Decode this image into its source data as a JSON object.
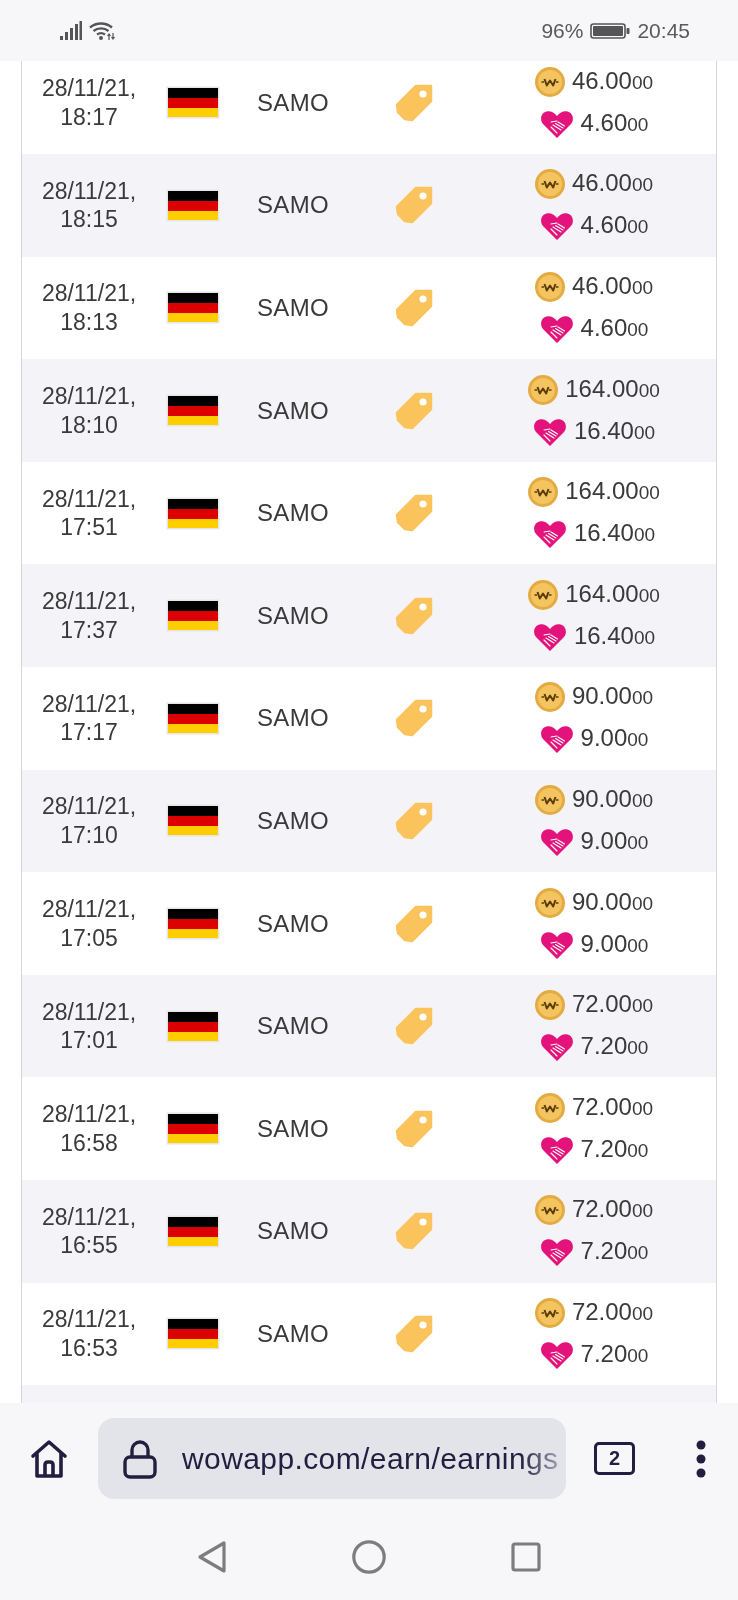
{
  "status_bar": {
    "battery": "96%",
    "time": "20:45"
  },
  "earnings": {
    "rows": [
      {
        "datetime": "28/11/21, 18:17",
        "user": "SAMO",
        "coins": {
          "main": "46.00",
          "extra": "00"
        },
        "hearts": {
          "main": "4.60",
          "extra": "00"
        }
      },
      {
        "datetime": "28/11/21, 18:15",
        "user": "SAMO",
        "coins": {
          "main": "46.00",
          "extra": "00"
        },
        "hearts": {
          "main": "4.60",
          "extra": "00"
        }
      },
      {
        "datetime": "28/11/21, 18:13",
        "user": "SAMO",
        "coins": {
          "main": "46.00",
          "extra": "00"
        },
        "hearts": {
          "main": "4.60",
          "extra": "00"
        }
      },
      {
        "datetime": "28/11/21, 18:10",
        "user": "SAMO",
        "coins": {
          "main": "164.00",
          "extra": "00"
        },
        "hearts": {
          "main": "16.40",
          "extra": "00"
        }
      },
      {
        "datetime": "28/11/21, 17:51",
        "user": "SAMO",
        "coins": {
          "main": "164.00",
          "extra": "00"
        },
        "hearts": {
          "main": "16.40",
          "extra": "00"
        }
      },
      {
        "datetime": "28/11/21, 17:37",
        "user": "SAMO",
        "coins": {
          "main": "164.00",
          "extra": "00"
        },
        "hearts": {
          "main": "16.40",
          "extra": "00"
        }
      },
      {
        "datetime": "28/11/21, 17:17",
        "user": "SAMO",
        "coins": {
          "main": "90.00",
          "extra": "00"
        },
        "hearts": {
          "main": "9.00",
          "extra": "00"
        }
      },
      {
        "datetime": "28/11/21, 17:10",
        "user": "SAMO",
        "coins": {
          "main": "90.00",
          "extra": "00"
        },
        "hearts": {
          "main": "9.00",
          "extra": "00"
        }
      },
      {
        "datetime": "28/11/21, 17:05",
        "user": "SAMO",
        "coins": {
          "main": "90.00",
          "extra": "00"
        },
        "hearts": {
          "main": "9.00",
          "extra": "00"
        }
      },
      {
        "datetime": "28/11/21, 17:01",
        "user": "SAMO",
        "coins": {
          "main": "72.00",
          "extra": "00"
        },
        "hearts": {
          "main": "7.20",
          "extra": "00"
        }
      },
      {
        "datetime": "28/11/21, 16:58",
        "user": "SAMO",
        "coins": {
          "main": "72.00",
          "extra": "00"
        },
        "hearts": {
          "main": "7.20",
          "extra": "00"
        }
      },
      {
        "datetime": "28/11/21, 16:55",
        "user": "SAMO",
        "coins": {
          "main": "72.00",
          "extra": "00"
        },
        "hearts": {
          "main": "7.20",
          "extra": "00"
        }
      },
      {
        "datetime": "28/11/21, 16:53",
        "user": "SAMO",
        "coins": {
          "main": "72.00",
          "extra": "00"
        },
        "hearts": {
          "main": "7.20",
          "extra": "00"
        }
      }
    ]
  },
  "browser": {
    "url": "wowapp.com/earn/earnings",
    "tab_count": "2"
  }
}
